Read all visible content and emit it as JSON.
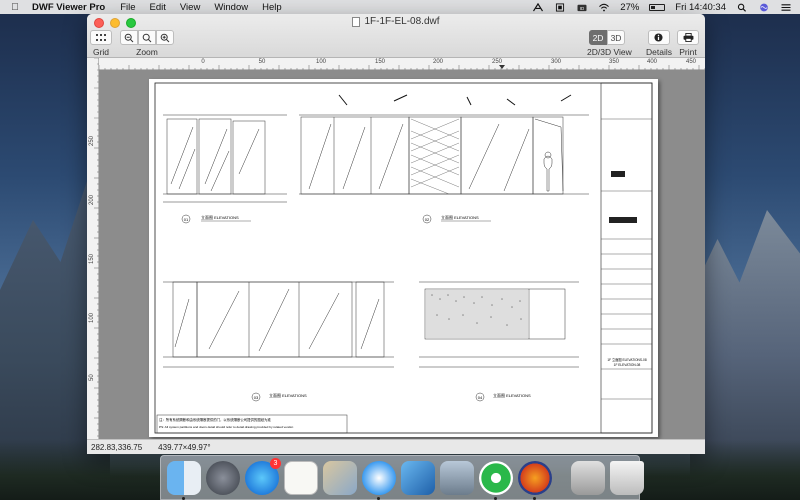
{
  "menubar": {
    "app_name": "DWF Viewer Pro",
    "menus": [
      "File",
      "Edit",
      "View",
      "Window",
      "Help"
    ],
    "battery_percent": "27%",
    "clock": "Fri 14:40:34"
  },
  "window": {
    "title": "1F-1F-EL-08.dwf"
  },
  "toolbar": {
    "grid_label": "Grid",
    "zoom_label": "Zoom",
    "seg_2d": "2D",
    "seg_3d": "3D",
    "view_label": "2D/3D View",
    "details_label": "Details",
    "print_label": "Print"
  },
  "ruler": {
    "top_ticks": [
      "0",
      "50",
      "100",
      "150",
      "200",
      "250",
      "300",
      "350",
      "400",
      "450"
    ],
    "left_ticks": [
      "250",
      "200",
      "150",
      "100",
      "50"
    ]
  },
  "drawing": {
    "elevation_1": "立面图 ELEVATIONS",
    "elevation_2": "立面图 ELEVATIONS",
    "elevation_3": "立面图 ELEVATIONS",
    "elevation_4": "立面图 ELEVATIONS",
    "tag_1": "01",
    "tag_2": "02",
    "tag_3": "03",
    "tag_4": "04",
    "note_cn": "注：所有系统隔断和由系统隔断提供的门，以系统隔断公司提供的图纸为准",
    "note_en": "PS: All system partitions and doors detail should refer to detail drawing provided by related vendor.",
    "title_block_name": "1F 立面图 ELEVATIONS-08",
    "title_block_sub": "1F ELEVATION-08"
  },
  "statusbar": {
    "coords": "282.83,336.75",
    "size": "439.77×49.97°"
  },
  "dock": {
    "appstore_badge": "3",
    "apps": [
      "finder",
      "launchpad",
      "app-store",
      "textedit",
      "mail",
      "safari",
      "xcode",
      "preview",
      "dwf-viewer",
      "firefox",
      "downloads",
      "trash"
    ]
  }
}
